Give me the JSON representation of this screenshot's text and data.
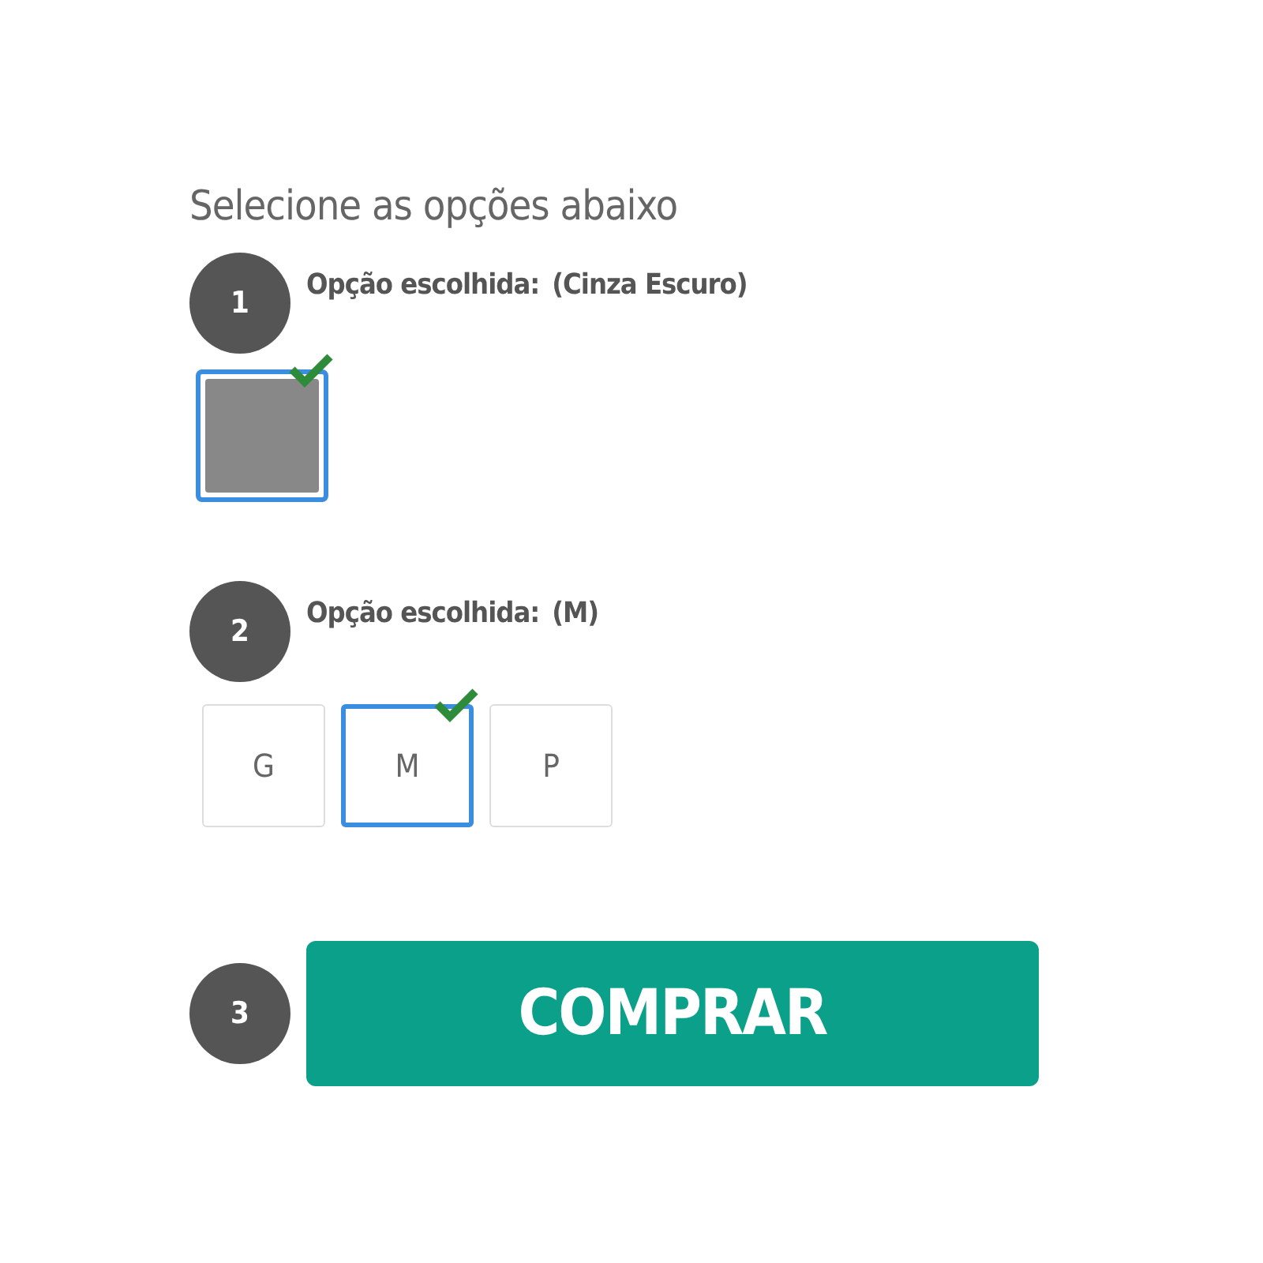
{
  "heading": "Selecione as opções abaixo",
  "steps": [
    {
      "number": "1",
      "kind": "color",
      "label": "Opção escolhida:",
      "value": "(Cinza Escuro)",
      "swatches": [
        {
          "color": "#888888",
          "selected": true
        }
      ]
    },
    {
      "number": "2",
      "kind": "size",
      "label": "Opção escolhida:",
      "value": "(M)",
      "options": [
        {
          "label": "G",
          "selected": false
        },
        {
          "label": "M",
          "selected": true
        },
        {
          "label": "P",
          "selected": false
        }
      ]
    },
    {
      "number": "3",
      "kind": "button",
      "label": "COMPRAR"
    }
  ]
}
